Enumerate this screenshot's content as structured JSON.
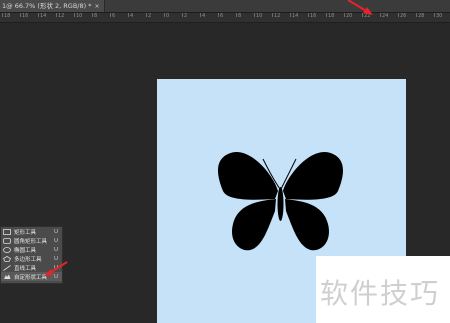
{
  "tab": {
    "title": "1@ 66.7% (形状 2, RGB/8) *",
    "close": "×"
  },
  "ruler": {
    "labels": [
      "18",
      "16",
      "14",
      "12",
      "10",
      "8",
      "6",
      "4",
      "2",
      "0",
      "2",
      "4",
      "6",
      "8",
      "10",
      "12",
      "14",
      "16",
      "18",
      "20",
      "22",
      "24",
      "26",
      "28",
      "30"
    ]
  },
  "flyout": {
    "items": [
      {
        "label": "矩形工具",
        "key": "U",
        "icon": "rectangle-icon"
      },
      {
        "label": "圆角矩形工具",
        "key": "U",
        "icon": "rounded-rectangle-icon"
      },
      {
        "label": "椭圆工具",
        "key": "U",
        "icon": "ellipse-icon"
      },
      {
        "label": "多边形工具",
        "key": "U",
        "icon": "polygon-icon"
      },
      {
        "label": "直线工具",
        "key": "U",
        "icon": "line-icon"
      },
      {
        "label": "自定形状工具",
        "key": "U",
        "icon": "custom-shape-icon"
      }
    ]
  },
  "watermark": {
    "text": "软件技巧"
  },
  "colors": {
    "document": "#c5e2f8",
    "workspace": "#282828",
    "arrow": "#e8232a"
  }
}
